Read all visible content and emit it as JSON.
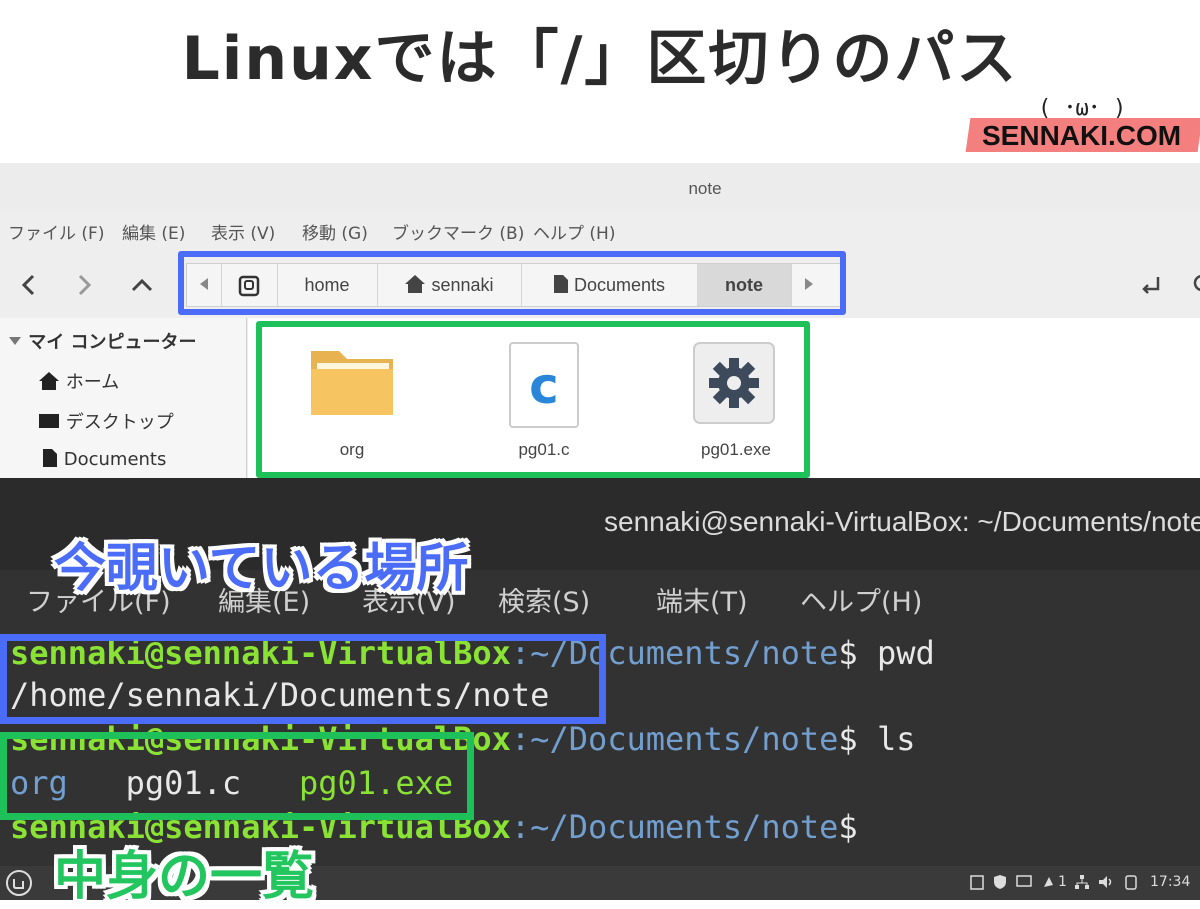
{
  "banner": {
    "title": "Linuxでは「/」区切りのパス",
    "logo_face": "( ･ω･ )",
    "logo_text": "SENNAKI.COM"
  },
  "file_manager": {
    "window_title": "note",
    "menu": [
      "ファイル (F)",
      "編集 (E)",
      "表示 (V)",
      "移動 (G)",
      "ブックマーク (B)",
      "ヘルプ (H)"
    ],
    "nav": {
      "back": "‹",
      "forward": "›",
      "up": "^"
    },
    "breadcrumbs": [
      "home",
      "sennaki",
      "Documents",
      "note"
    ],
    "sidebar": {
      "header": "マイ コンピューター",
      "items": [
        "ホーム",
        "デスクトップ",
        "Documents"
      ]
    },
    "files": [
      {
        "name": "org",
        "icon": "folder-icon"
      },
      {
        "name": "pg01.c",
        "icon": "c-source-icon"
      },
      {
        "name": "pg01.exe",
        "icon": "gear-icon"
      }
    ]
  },
  "terminal": {
    "title": "sennaki@sennaki-VirtualBox: ~/Documents/note",
    "menu": [
      "ファイル(F)",
      "編集(E)",
      "表示(V)",
      "検索(S)",
      "端末(T)",
      "ヘルプ(H)"
    ],
    "prompt_user": "sennaki@sennaki-VirtualBox",
    "prompt_path": ":~/Documents/note",
    "lines": [
      {
        "cmd": "$ pwd"
      },
      {
        "output": "/home/sennaki/Documents/note"
      },
      {
        "cmd": "$ ls"
      },
      {
        "ls": [
          "org",
          "pg01.c",
          "pg01.exe"
        ]
      },
      {
        "cmd": "$"
      }
    ]
  },
  "callouts": {
    "current_location": "今覗いている場所",
    "contents_list": "中身の一覧"
  },
  "taskbar": {
    "workspace": "1",
    "clock": "17:34"
  },
  "colors": {
    "highlight_blue": "#4a6cf7",
    "highlight_green": "#1ec05a",
    "prompt_green": "#8ae234",
    "dir_blue": "#729fcf",
    "logo_pink": "#f47f7f"
  }
}
